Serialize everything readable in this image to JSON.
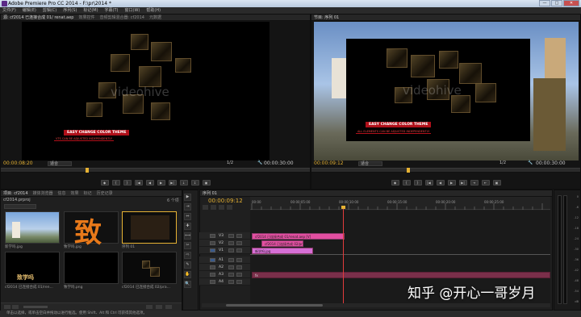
{
  "window": {
    "title": "Adobe Premiere Pro CC 2014 - F:\\pr\\2014 *",
    "btn_min": "—",
    "btn_max": "□",
    "btn_close": "✕"
  },
  "menu": [
    "文件(F)",
    "编辑(E)",
    "剪辑(C)",
    "序列(S)",
    "标记(M)",
    "字幕(T)",
    "窗口(W)",
    "帮助(H)"
  ],
  "source_monitor": {
    "tabs": [
      "源: cf2014 已连接合成 01/ renat.aep",
      "效果控件",
      "音频剪辑混合器: cf2014",
      "元数据"
    ],
    "timecode_in": "00:00:08:20",
    "fit": "适合",
    "fraction": "1/2",
    "timecode_out": "00:00:30:00",
    "banner_main": "EASY CHANGE COLOR THEME",
    "banner_sub": "VTS CAN BE ADJUSTED INDEPENDENTLY",
    "watermark": "videohive",
    "controls": [
      "◆",
      "{",
      "}",
      "|◀",
      "◀",
      "▶",
      "▶|",
      "↓",
      "↧",
      "▣"
    ]
  },
  "program_monitor": {
    "tabs": [
      "节目: 序列 01"
    ],
    "timecode_in": "00:00:09:12",
    "fit": "适合",
    "fraction": "1/2",
    "timecode_out": "00:00:30:00",
    "banner_main": "EASY CHANGE COLOR THEME",
    "banner_sub": "ALL ELEMENTS CAN BE ADJUSTED INDEPENDENTLY",
    "watermark": "videohive",
    "controls": [
      "◆",
      "{",
      "}",
      "|◀",
      "◀",
      "▶",
      "▶|",
      "⇥",
      "⇤",
      "▣"
    ]
  },
  "project": {
    "tabs": [
      "项目: cf2014",
      "媒体浏览器",
      "信息",
      "效果",
      "标记",
      "历史记录"
    ],
    "project_file": "cf2014.prproj",
    "item_count": "6 个项",
    "items": [
      {
        "label": "新学吗.jpg",
        "type": "image"
      },
      {
        "label": "致学吗.jpg",
        "type": "text-orange"
      },
      {
        "label": "序列 01",
        "type": "sequence"
      },
      {
        "label": "cf2014 已连接合成 01/ren...",
        "type": "black"
      },
      {
        "label": "致学吗.png",
        "type": "black-text"
      },
      {
        "label": "cf2014 已连接合成 02/pra...",
        "type": "cubes"
      }
    ],
    "thumb_caption": "致学吗"
  },
  "tools": [
    "▶",
    "⇥",
    "⇔",
    "✚",
    "⟺",
    "✂",
    "⇨",
    "✎",
    "✋",
    "🔍"
  ],
  "timeline": {
    "tab": "序列 01",
    "timecode": "00:00:09:12",
    "ruler": [
      "00:00",
      "00:00:05:00",
      "00:00:10:00",
      "00:00:15:00",
      "00:00:20:00",
      "00:00:25:00"
    ],
    "video_tracks": [
      {
        "name": "V3",
        "clip": "cf2014 已连接合成 01/renat.aep [V]",
        "start": 0.0,
        "end": 9.6,
        "color": "#e24fa1"
      },
      {
        "name": "V2",
        "clip": "cf2014 已连接合成 02/prdl.aep",
        "start": 1.0,
        "end": 5.3,
        "color": "#e24fa1"
      },
      {
        "name": "V1",
        "clip": "新学吗.jpg",
        "start": 0.0,
        "end": 6.3,
        "color": "#d66fd6"
      }
    ],
    "audio_tracks": [
      "A1",
      "A2",
      "A3",
      "A4"
    ],
    "audio_clip_label": "fx",
    "audio_clip_start": 0.0,
    "audio_clip_end": 9.6,
    "playhead_sec": 9.4
  },
  "meter": {
    "ticks": [
      "0",
      "-6",
      "-12",
      "-18",
      "-24",
      "-30",
      "-36",
      "-42",
      "-48",
      "-54",
      "dB"
    ]
  },
  "status": "单击以选择，或单击空白并拖动以进行框选。使用 Shift、Alt 和 Ctrl 可获得其他选项。",
  "watermark_overlay": "知乎 @开心一哥岁月"
}
